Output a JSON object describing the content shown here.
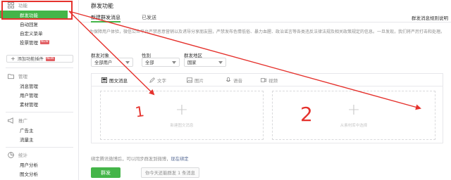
{
  "sidebar": {
    "sections": [
      {
        "title": "功能",
        "icon": "grid-icon"
      },
      {
        "title": "管理",
        "icon": "folder-icon"
      },
      {
        "title": "推广",
        "icon": "megaphone-icon"
      },
      {
        "title": "统计",
        "icon": "pie-chart-icon"
      }
    ],
    "function_items": [
      {
        "label": "群发功能",
        "active": true
      },
      {
        "label": "自动回复"
      },
      {
        "label": "自定义菜单"
      },
      {
        "label": "投票管理",
        "badge": "NEW"
      }
    ],
    "add_plugin": {
      "label": "添加功能插件",
      "badge": "NEW"
    },
    "manage_items": [
      {
        "label": "消息管理"
      },
      {
        "label": "用户管理"
      },
      {
        "label": "素材管理"
      }
    ],
    "promo_items": [
      {
        "label": "广告主"
      },
      {
        "label": "流量主"
      }
    ],
    "stats_items": [
      {
        "label": "用户分析"
      },
      {
        "label": "图文分析"
      }
    ]
  },
  "main": {
    "title": "群发功能",
    "tabs": [
      {
        "label": "新建群发消息",
        "active": true
      },
      {
        "label": "已发送"
      }
    ],
    "tab_right": "群发消息规则说明",
    "notice": "为保障用户体验，微信公众平台严禁恶意营销以及诱导分享朋友圈，严禁发布色情低俗、暴力血腥、政治谣言等各类违反法律法规及相关政策规定的信息。一旦发现，我们将严厉打击和处理。",
    "filters": [
      {
        "label": "群发对象",
        "value": "全部用户"
      },
      {
        "label": "性别",
        "value": "全部"
      },
      {
        "label": "群发地区",
        "value": "国家"
      }
    ],
    "type_tabs": [
      {
        "label": "图文消息",
        "icon": "article-icon",
        "active": true
      },
      {
        "label": "文字",
        "icon": "pen-icon"
      },
      {
        "label": "图片",
        "icon": "image-icon"
      },
      {
        "label": "语音",
        "icon": "voice-icon"
      },
      {
        "label": "视频",
        "icon": "video-icon"
      }
    ],
    "cards": [
      {
        "caption": "新建图文消息"
      },
      {
        "caption": "从素材库中选择"
      }
    ],
    "weibo_text": "绑定腾讯微博后，可以同步群发到微博，",
    "weibo_link": "现在绑定",
    "send_label": "群发",
    "quota_text": "你今天还能群发 1 条消息"
  },
  "annotations": {
    "label_1": "1",
    "label_2": "2",
    "color": "#e5322d"
  }
}
